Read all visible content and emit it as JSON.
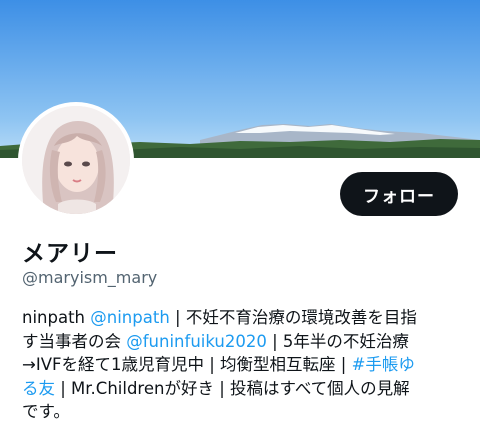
{
  "profile": {
    "display_name": "メアリー",
    "handle": "@maryism_mary",
    "follow_label": "フォロー"
  },
  "bio": {
    "l1_a": "ninpath ",
    "l1_link": "@ninpath",
    "l1_b": " | 不妊不育治療の環境改善を目指",
    "l2_a": "す当事者の会 ",
    "l2_link": "@funinfuiku2020",
    "l2_b": " | 5年半の不妊治療",
    "l3_a": "→IVFを経て1歳児育児中 | 均衡型相互転座 | ",
    "l3_link": "#手帳ゆ",
    "l4_link": "る友",
    "l4_b": " |  Mr.Childrenが好き | 投稿はすべて個人の見解",
    "l5": "です。"
  },
  "colors": {
    "link": "#1d9bf0",
    "button_bg": "#0f1419",
    "secondary_text": "#536471"
  }
}
